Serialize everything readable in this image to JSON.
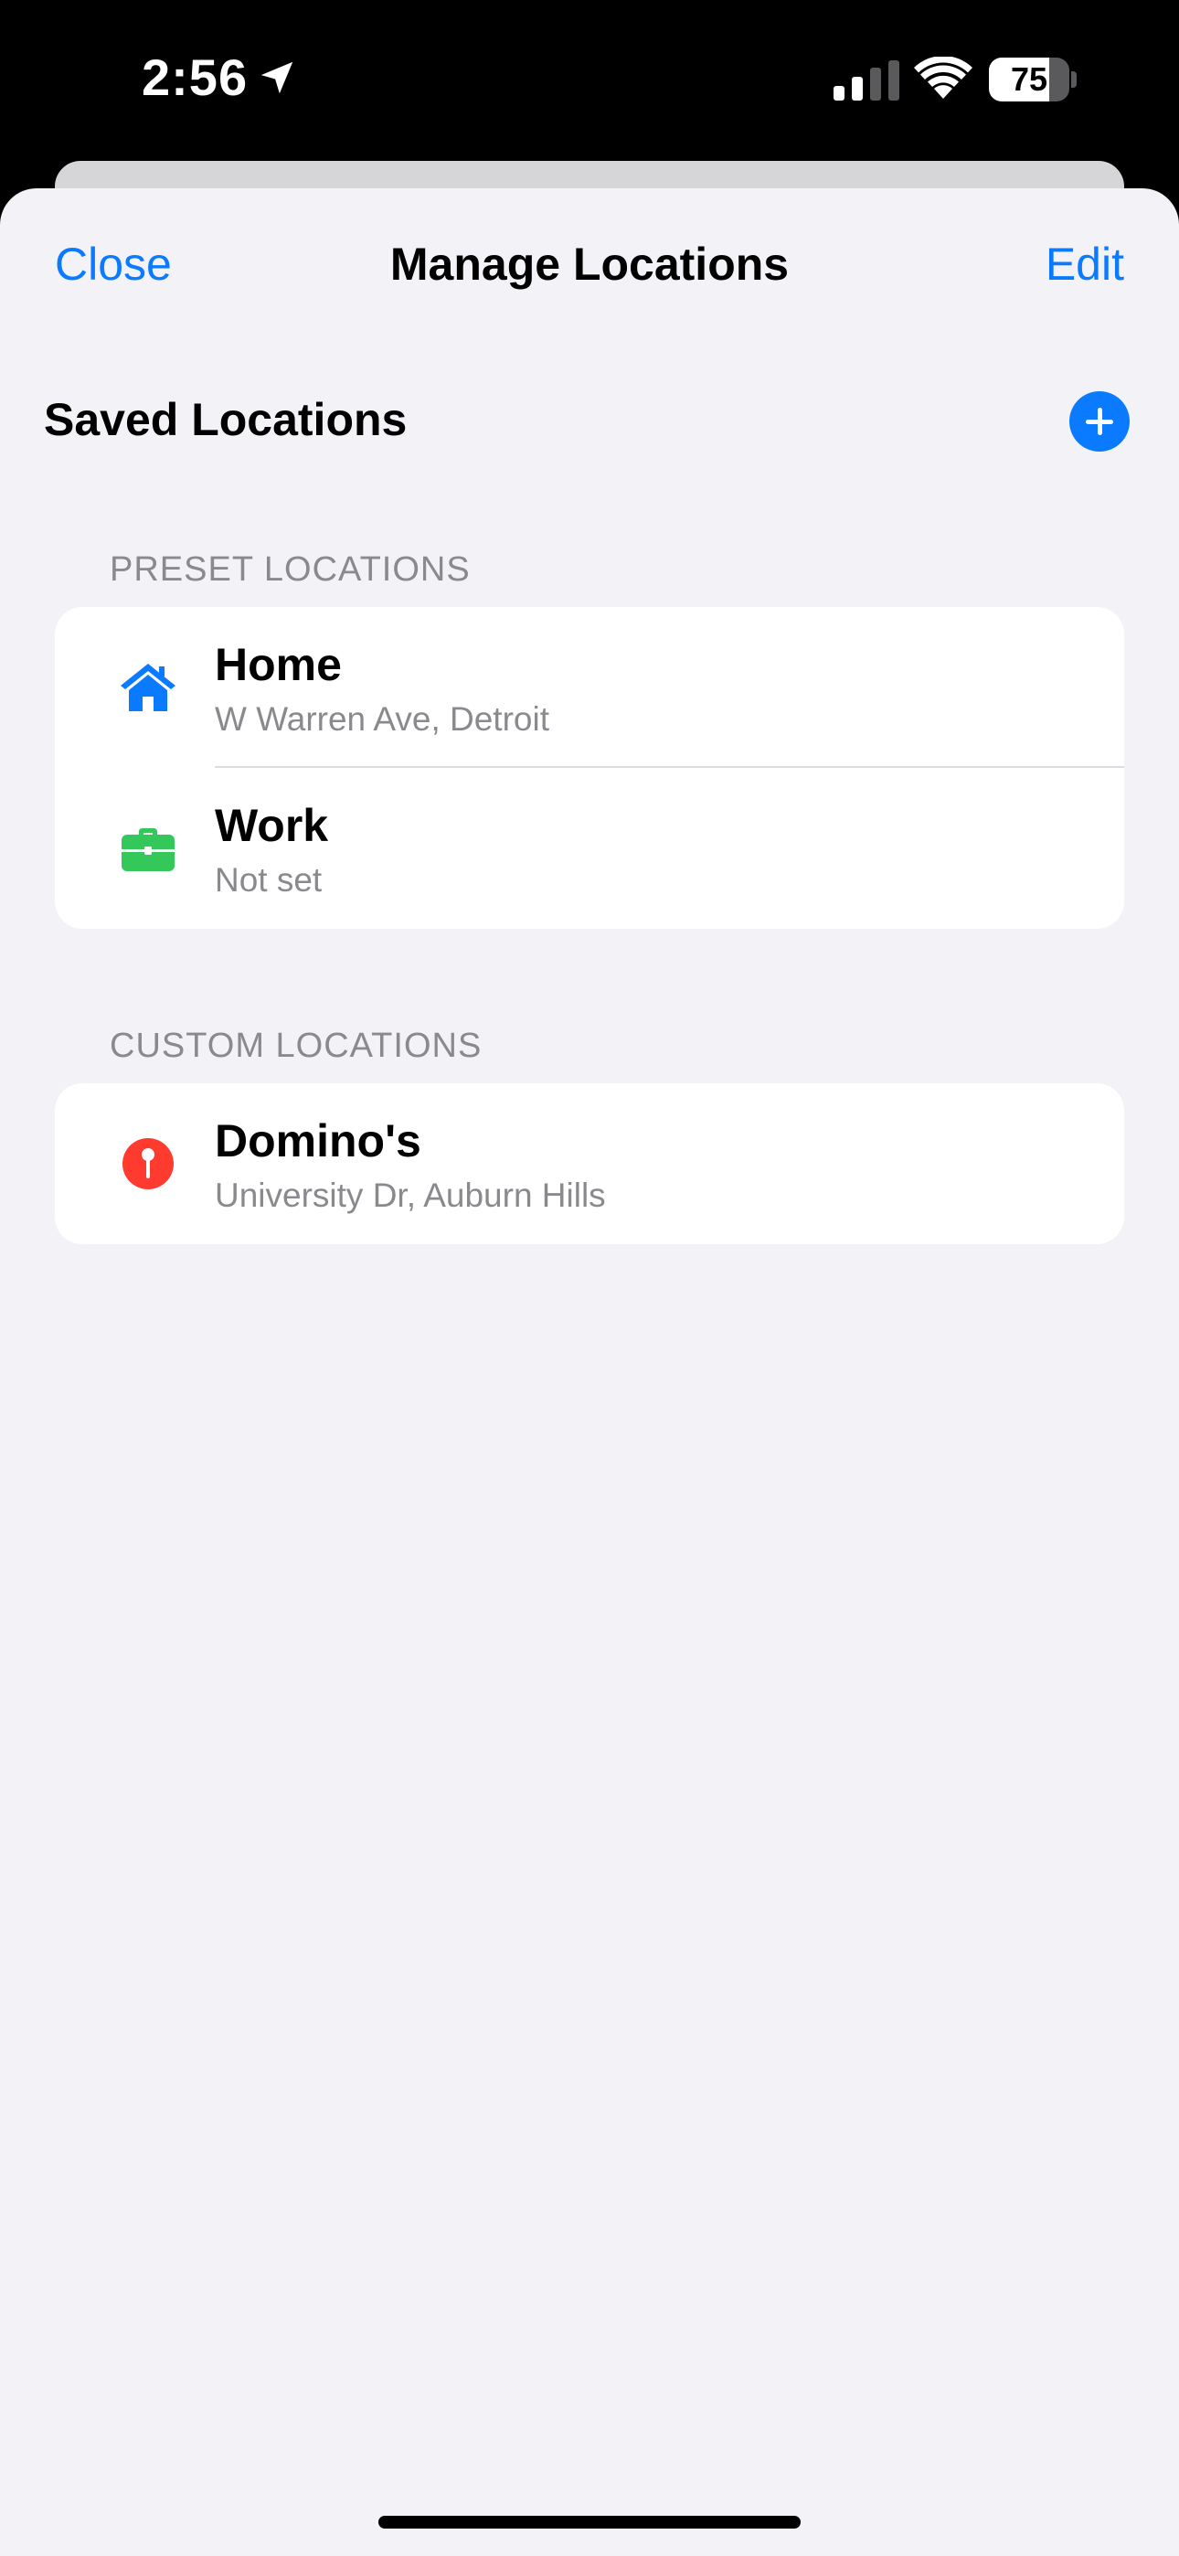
{
  "status_bar": {
    "time": "2:56",
    "battery_percent": "75",
    "battery_level": 0.75
  },
  "nav": {
    "close_label": "Close",
    "title": "Manage Locations",
    "edit_label": "Edit"
  },
  "saved": {
    "heading": "Saved Locations"
  },
  "preset": {
    "header": "PRESET LOCATIONS",
    "items": [
      {
        "title": "Home",
        "subtitle": "W Warren Ave, Detroit",
        "icon": "house-icon",
        "color": "#0a7aff"
      },
      {
        "title": "Work",
        "subtitle": "Not set",
        "icon": "briefcase-icon",
        "color": "#34c759"
      }
    ]
  },
  "custom": {
    "header": "CUSTOM LOCATIONS",
    "items": [
      {
        "title": "Domino's",
        "subtitle": "University Dr, Auburn Hills",
        "icon": "pin-icon",
        "color": "#ff3b30"
      }
    ]
  },
  "colors": {
    "accent": "#0a7aff",
    "background": "#f2f2f7",
    "secondary_text": "#8a8a8e"
  }
}
